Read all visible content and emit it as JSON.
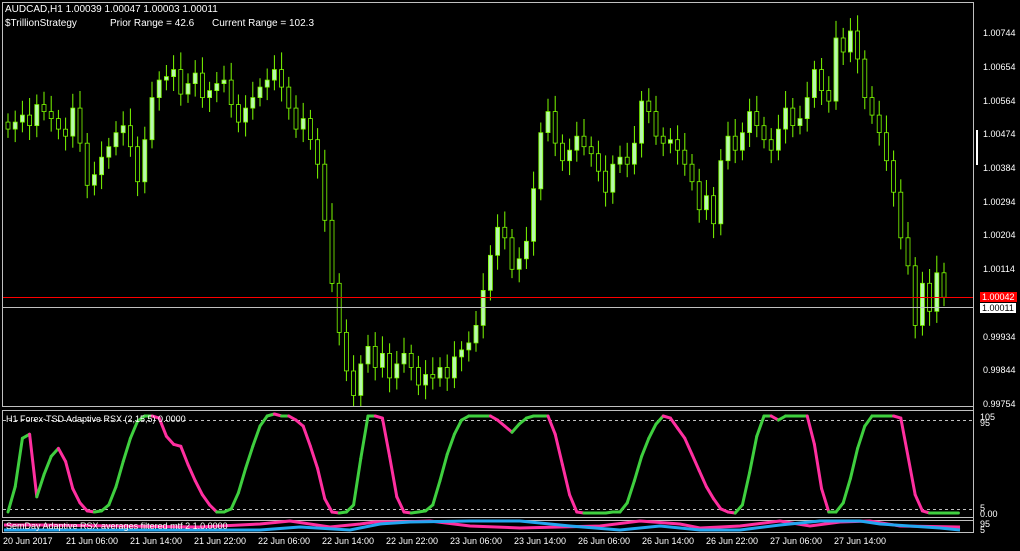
{
  "header": {
    "symbol_line": "AUDCAD,H1  1.00039 1.00047 1.00003 1.00011",
    "strategy_label": "$TrillionStrategy",
    "prior_range": "Prior Range = 42.6",
    "current_range": "Current Range = 102.3"
  },
  "colors": {
    "background": "#000000",
    "bull_candle": "#b8f7b0",
    "wick": "#7cfc00",
    "bid_line": "#ff0000",
    "last_line": "#c0c0c0",
    "rsx_up": "#3fcf3f",
    "rsx_down": "#ff2fa0",
    "rsx2_blue": "#23a6f0",
    "grid_dash": "#c0c0c0"
  },
  "price_axis": {
    "levels": [
      "1.00744",
      "1.00654",
      "1.00564",
      "1.00474",
      "1.00384",
      "1.00294",
      "1.00204",
      "1.00114",
      "0.99934",
      "0.99844",
      "0.99754"
    ],
    "bid_tag": "1.00042",
    "last_tag": "1.00011"
  },
  "time_axis": {
    "labels": [
      "20 Jun 2017",
      "21 Jun 06:00",
      "21 Jun 14:00",
      "21 Jun 22:00",
      "22 Jun 06:00",
      "22 Jun 14:00",
      "22 Jun 22:00",
      "23 Jun 06:00",
      "23 Jun 14:00",
      "26 Jun 06:00",
      "26 Jun 14:00",
      "26 Jun 22:00",
      "27 Jun 06:00",
      "27 Jun 14:00"
    ]
  },
  "indicator1": {
    "title": "H1 Forex-TSD Adaptive RSX (2,15,5) 0.0000",
    "level_high_a": "105",
    "level_high_b": "95",
    "level_low_a": "5",
    "level_low_b": "0.00"
  },
  "indicator2": {
    "title": "SemDay Adaptive RSX averages filtered mtf 2  1.0.0000",
    "level_a": "95",
    "level_b": "5"
  },
  "chart_data": [
    {
      "type": "candlestick",
      "symbol": "AUDCAD",
      "timeframe": "H1",
      "last_bar": {
        "open": 1.00039,
        "high": 1.00047,
        "low": 1.00003,
        "close": 1.00011
      },
      "y_axis_ticks": [
        1.00744,
        1.00654,
        1.00564,
        1.00474,
        1.00384,
        1.00294,
        1.00204,
        1.00114,
        0.99934,
        0.99844,
        0.99754
      ],
      "ylim": [
        0.997,
        1.0085
      ],
      "bid_price": 1.00042,
      "last_price": 1.00011,
      "x_tick_labels": [
        "20 Jun 2017",
        "21 Jun 06:00",
        "21 Jun 14:00",
        "21 Jun 22:00",
        "22 Jun 06:00",
        "22 Jun 14:00",
        "22 Jun 22:00",
        "23 Jun 06:00",
        "23 Jun 14:00",
        "26 Jun 06:00",
        "26 Jun 14:00",
        "26 Jun 22:00",
        "27 Jun 06:00",
        "27 Jun 14:00"
      ],
      "closes": [
        1.0049,
        1.0051,
        1.0053,
        1.005,
        1.0056,
        1.0054,
        1.0052,
        1.0049,
        1.0047,
        1.0055,
        1.0045,
        1.0033,
        1.0036,
        1.0041,
        1.0044,
        1.0048,
        1.005,
        1.0044,
        1.0034,
        1.0046,
        1.0058,
        1.0063,
        1.0064,
        1.0066,
        1.0059,
        1.0062,
        1.0065,
        1.0058,
        1.006,
        1.0062,
        1.0063,
        1.0056,
        1.0051,
        1.0055,
        1.0058,
        1.0061,
        1.0063,
        1.0066,
        1.0061,
        1.0055,
        1.0049,
        1.0052,
        1.0046,
        1.0039,
        1.0023,
        1.0005,
        0.9991,
        0.998,
        0.9973,
        0.9982,
        0.9987,
        0.9981,
        0.9985,
        0.9978,
        0.9982,
        0.9985,
        0.9981,
        0.9976,
        0.9979,
        0.9978,
        0.9981,
        0.9978,
        0.9984,
        0.9986,
        0.9988,
        0.9993,
        1.0003,
        1.0013,
        1.0021,
        1.0018,
        1.0009,
        1.0012,
        1.0017,
        1.0032,
        1.0048,
        1.0054,
        1.0045,
        1.004,
        1.0043,
        1.0047,
        1.0044,
        1.0042,
        1.0037,
        1.0031,
        1.0039,
        1.0041,
        1.0039,
        1.0045,
        1.0057,
        1.0054,
        1.0047,
        1.0045,
        1.0046,
        1.0043,
        1.0039,
        1.0034,
        1.0026,
        1.003,
        1.0022,
        1.004,
        1.0047,
        1.0043,
        1.0048,
        1.0054,
        1.005,
        1.0046,
        1.0043,
        1.0049,
        1.0055,
        1.005,
        1.0052,
        1.0058,
        1.0066,
        1.006,
        1.0057,
        1.0075,
        1.0071,
        1.0077,
        1.0069,
        1.0058,
        1.0053,
        1.0048,
        1.004,
        1.0031,
        1.0018,
        1.001,
        0.9993,
        1.0005,
        0.9997,
        1.0008,
        1.0001
      ]
    },
    {
      "type": "line",
      "name": "H1 Forex-TSD Adaptive RSX (2,15,5) 0.0000",
      "ylim": [
        0,
        105
      ],
      "levels": [
        95,
        5
      ],
      "values": [
        5,
        30,
        78,
        82,
        20,
        42,
        60,
        68,
        55,
        28,
        14,
        6,
        5,
        6,
        12,
        30,
        55,
        78,
        95,
        100,
        100,
        98,
        80,
        72,
        70,
        52,
        36,
        22,
        12,
        5,
        5,
        8,
        24,
        48,
        70,
        90,
        100,
        102,
        100,
        100,
        96,
        90,
        70,
        48,
        18,
        5,
        4,
        5,
        12,
        58,
        100,
        100,
        98,
        60,
        20,
        5,
        4,
        5,
        6,
        12,
        36,
        62,
        82,
        96,
        100,
        100,
        100,
        100,
        96,
        90,
        84,
        92,
        98,
        100,
        100,
        100,
        82,
        52,
        22,
        5,
        4,
        4,
        4,
        4,
        5,
        5,
        14,
        36,
        60,
        78,
        92,
        100,
        98,
        88,
        78,
        62,
        46,
        30,
        18,
        8,
        5,
        4,
        12,
        44,
        80,
        100,
        100,
        96,
        100,
        100,
        100,
        100,
        72,
        28,
        5,
        5,
        14,
        38,
        68,
        90,
        100,
        100,
        100,
        100,
        98,
        60,
        22,
        6,
        4,
        4,
        4,
        4,
        4
      ]
    },
    {
      "type": "line",
      "name": "SemDay Adaptive RSX averages filtered mtf 2  1.0.0000",
      "ylim": [
        0,
        100
      ],
      "levels": [
        95,
        5
      ]
    }
  ]
}
